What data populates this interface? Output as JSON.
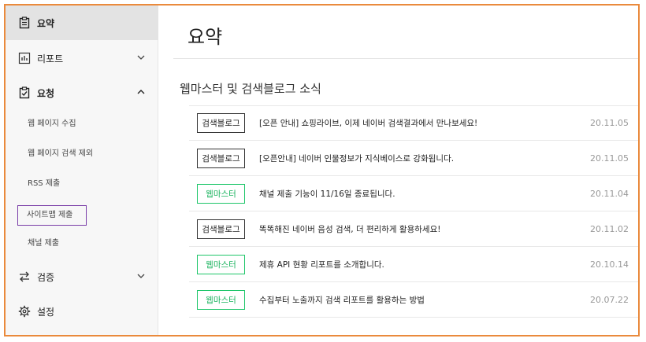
{
  "sidebar": {
    "summary": "요약",
    "report": "리포트",
    "request": "요청",
    "request_items": [
      "웹 페이지 수집",
      "웹 페이지 검색 제외",
      "RSS 제출",
      "사이트맵 제출",
      "채널 제출"
    ],
    "verify": "검증",
    "settings": "설정"
  },
  "main": {
    "title": "요약",
    "section_title": "웹마스터 및 검색블로그 소식",
    "news": [
      {
        "tag": "검색블로그",
        "type": "blog",
        "text": "[오픈 안내] 쇼핑라이브, 이제 네이버 검색결과에서 만나보세요!",
        "date": "20.11.05"
      },
      {
        "tag": "검색블로그",
        "type": "blog",
        "text": "[오픈안내] 네이버 인물정보가 지식베이스로 강화됩니다.",
        "date": "20.11.05"
      },
      {
        "tag": "웹마스터",
        "type": "wm",
        "text": "채널 제출 기능이 11/16일 종료됩니다.",
        "date": "20.11.04"
      },
      {
        "tag": "검색블로그",
        "type": "blog",
        "text": "똑똑해진 네이버 음성 검색, 더 편리하게 활용하세요!",
        "date": "20.11.02"
      },
      {
        "tag": "웹마스터",
        "type": "wm",
        "text": "제휴 API 현황 리포트를 소개합니다.",
        "date": "20.10.14"
      },
      {
        "tag": "웹마스터",
        "type": "wm",
        "text": "수집부터 노출까지 검색 리포트를 활용하는 방법",
        "date": "20.07.22"
      }
    ]
  },
  "colors": {
    "accent_green": "#1ec66a",
    "frame_orange": "#ea8a3c",
    "selected_border": "#7a3ea8"
  }
}
